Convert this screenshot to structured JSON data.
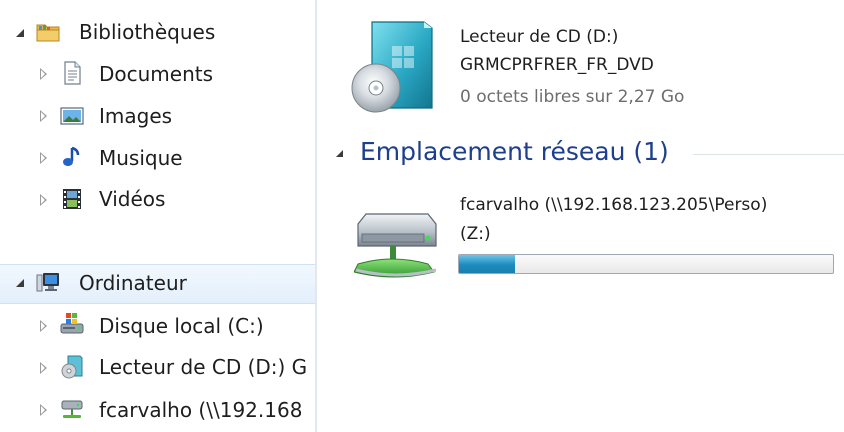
{
  "nav": {
    "libraries": {
      "label": "Bibliothèques",
      "icon": "libraries-folder-icon",
      "expanded": true
    },
    "library_items": [
      {
        "label": "Documents",
        "icon": "documents-icon"
      },
      {
        "label": "Images",
        "icon": "images-icon"
      },
      {
        "label": "Musique",
        "icon": "music-icon"
      },
      {
        "label": "Vidéos",
        "icon": "videos-icon"
      }
    ],
    "computer": {
      "label": "Ordinateur",
      "icon": "computer-icon",
      "expanded": true,
      "selected": true
    },
    "computer_items": [
      {
        "label": "Disque local (C:)",
        "icon": "local-disk-icon"
      },
      {
        "label": "Lecteur de CD (D:) G",
        "icon": "cd-drive-icon"
      },
      {
        "label": "fcarvalho (\\\\192.168",
        "icon": "network-drive-icon"
      }
    ]
  },
  "content": {
    "cd_drive": {
      "name": "Lecteur de CD (D:)",
      "volume_label": "GRMCPRFRER_FR_DVD",
      "free_space": "0 octets libres sur 2,27 Go",
      "icon": "dvd-drive-icon"
    },
    "network_group": {
      "header": "Emplacement réseau (1)",
      "expanded": true
    },
    "network_drive": {
      "name": "fcarvalho (\\\\192.168.123.205\\Perso)",
      "letter": "(Z:)",
      "icon": "network-drive-icon",
      "used_fraction": 0.15
    }
  },
  "colors": {
    "group_header": "#1e3e8e",
    "selection": "#e3effb",
    "bar_fill": "#1c8bbf"
  }
}
